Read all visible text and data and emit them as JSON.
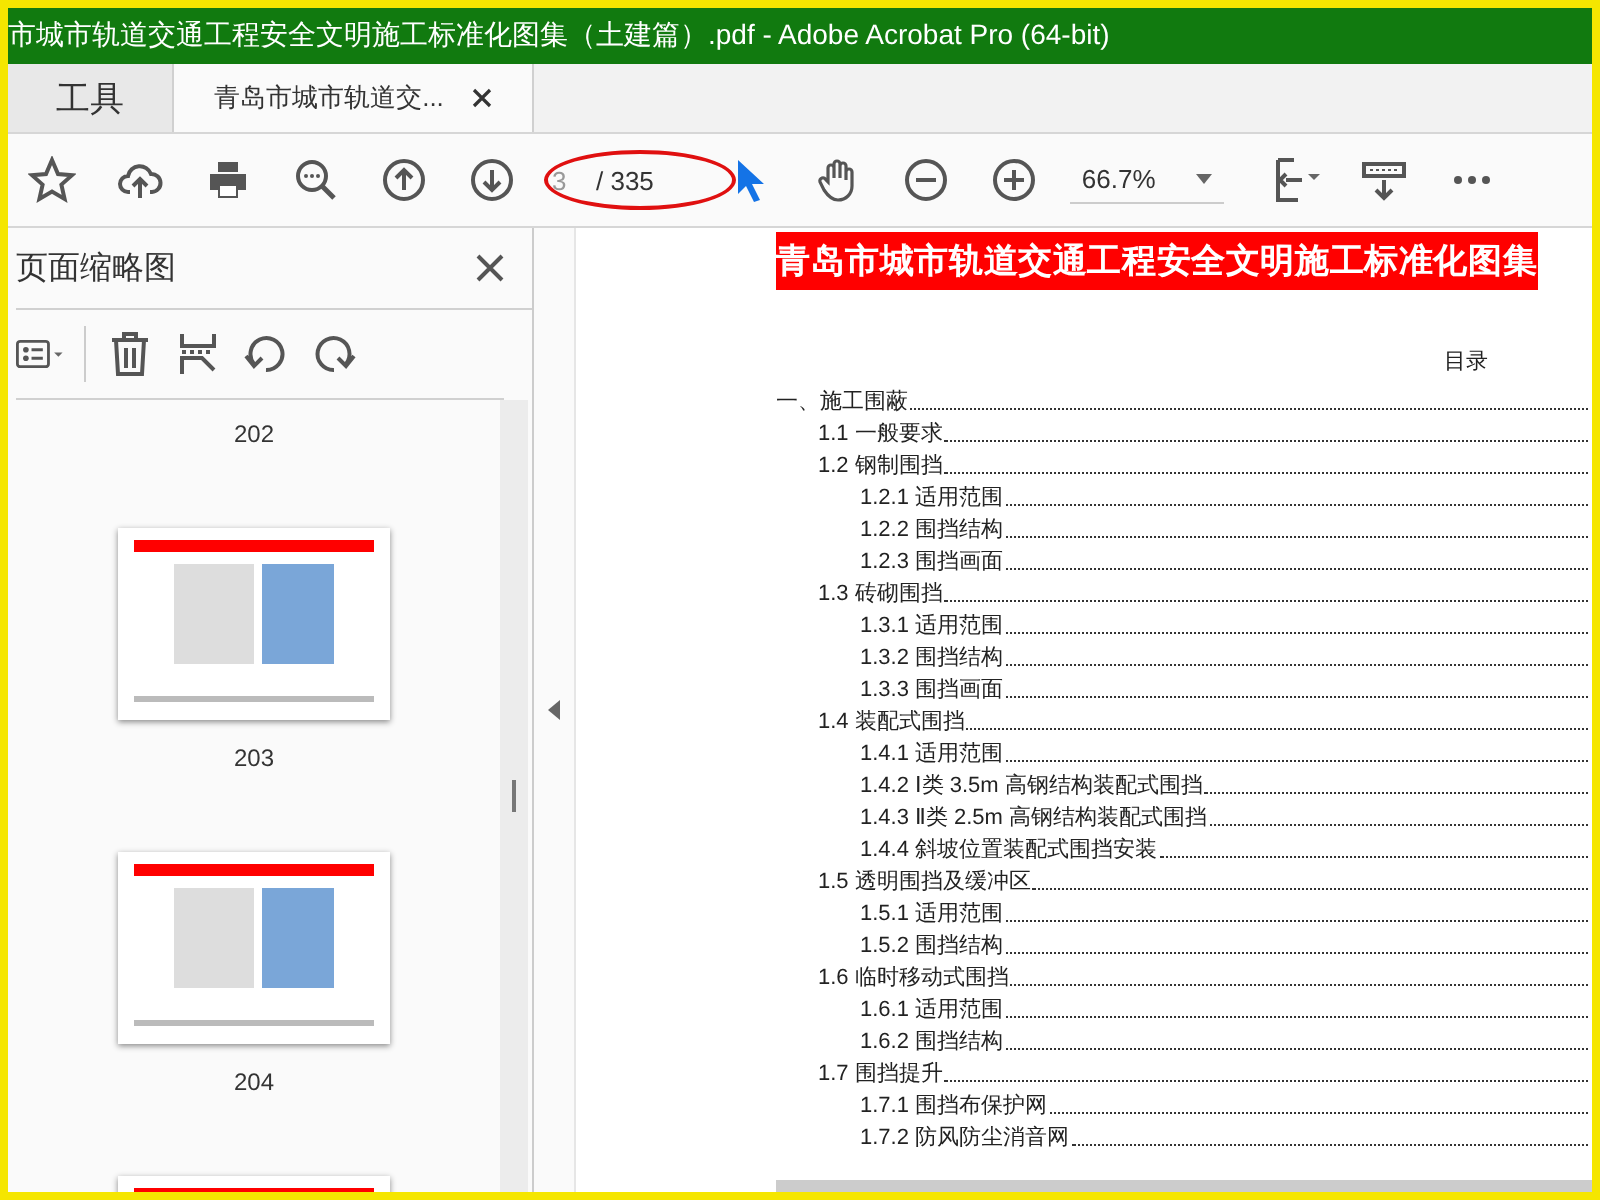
{
  "window": {
    "title": "市城市轨道交通工程安全文明施工标准化图集（土建篇）.pdf - Adobe Acrobat Pro (64-bit)"
  },
  "tabs": [
    {
      "label": "工具",
      "selected": false
    },
    {
      "label": "青岛市城市轨道交...",
      "selected": true
    }
  ],
  "toolbar": {
    "page_field": {
      "value": "3"
    },
    "page_total": "/ 335",
    "zoom": "66.7%",
    "tools": [
      {
        "kind": "select",
        "selected": true
      },
      {
        "kind": "hand",
        "selected": false
      }
    ]
  },
  "sidebar": {
    "title": "页面缩略图",
    "thumbnails": [
      {
        "label": "202"
      },
      {
        "label": "203",
        "kind": "figure"
      },
      {
        "label": "204",
        "kind": "figure"
      },
      {
        "kind": "text"
      }
    ]
  },
  "document": {
    "header": "青岛市城市轨道交通工程安全文明施工标准化图集",
    "toc_title": "目录",
    "toc": [
      {
        "text": "一、施工围蔽",
        "children": [
          {
            "text": "1.1 一般要求"
          },
          {
            "text": "1.2 钢制围挡",
            "children": [
              {
                "text": "1.2.1 适用范围"
              },
              {
                "text": "1.2.2 围挡结构"
              },
              {
                "text": "1.2.3 围挡画面"
              }
            ]
          },
          {
            "text": "1.3 砖砌围挡",
            "children": [
              {
                "text": "1.3.1 适用范围"
              },
              {
                "text": "1.3.2  围挡结构"
              },
              {
                "text": "1.3.3  围挡画面"
              }
            ]
          },
          {
            "text": "1.4 装配式围挡",
            "children": [
              {
                "text": "1.4.1  适用范围"
              },
              {
                "text": "1.4.2  Ⅰ类 3.5m 高钢结构装配式围挡"
              },
              {
                "text": "1.4.3  Ⅱ类 2.5m 高钢结构装配式围挡"
              },
              {
                "text": "1.4.4  斜坡位置装配式围挡安装"
              }
            ]
          },
          {
            "text": "1.5 透明围挡及缓冲区",
            "children": [
              {
                "text": "1.5.1 适用范围"
              },
              {
                "text": "1.5.2  围挡结构"
              }
            ]
          },
          {
            "text": "1.6 临时移动式围挡",
            "children": [
              {
                "text": "1.6.1 适用范围"
              },
              {
                "text": "1.6.2  围挡结构"
              }
            ]
          },
          {
            "text": "1.7  围挡提升",
            "children": [
              {
                "text": "1.7.1 围挡布保护网"
              },
              {
                "text": "1.7.2  防风防尘消音网"
              }
            ]
          }
        ]
      }
    ]
  }
}
